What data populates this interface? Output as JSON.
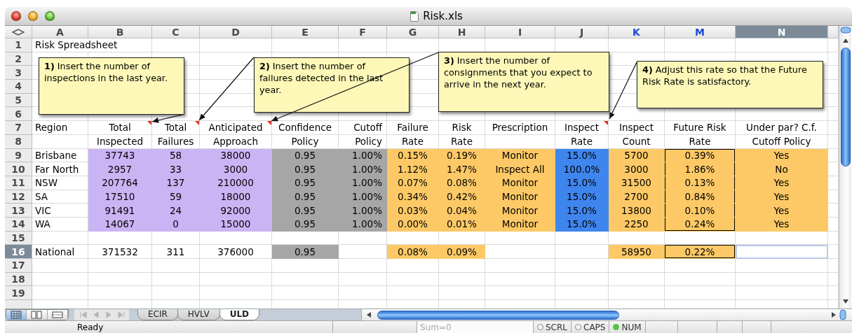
{
  "window": {
    "title": "Risk.xls"
  },
  "columns": [
    {
      "label": "A",
      "selected": false,
      "highlighted": false
    },
    {
      "label": "B",
      "selected": false,
      "highlighted": false
    },
    {
      "label": "C",
      "selected": false,
      "highlighted": false
    },
    {
      "label": "D",
      "selected": false,
      "highlighted": false
    },
    {
      "label": "E",
      "selected": false,
      "highlighted": false
    },
    {
      "label": "F",
      "selected": false,
      "highlighted": false
    },
    {
      "label": "G",
      "selected": false,
      "highlighted": false
    },
    {
      "label": "H",
      "selected": false,
      "highlighted": false
    },
    {
      "label": "I",
      "selected": false,
      "highlighted": false
    },
    {
      "label": "J",
      "selected": false,
      "highlighted": false
    },
    {
      "label": "K",
      "selected": false,
      "highlighted": true
    },
    {
      "label": "M",
      "selected": false,
      "highlighted": true
    },
    {
      "label": "N",
      "selected": true,
      "highlighted": false
    }
  ],
  "rows": [
    {
      "number": "1",
      "selected": false,
      "cells": [
        {
          "text": "Risk Spreadsheet",
          "comment": false,
          "boxed": false,
          "selected": false
        }
      ]
    },
    {
      "number": "2",
      "selected": false
    },
    {
      "number": "3",
      "selected": false
    },
    {
      "number": "4",
      "selected": false
    },
    {
      "number": "5",
      "selected": false
    },
    {
      "number": "6",
      "selected": false
    },
    {
      "number": "7",
      "selected": false,
      "cells": [
        {
          "text": "Region",
          "comment": false,
          "boxed": false,
          "selected": false
        },
        {
          "text": "Total",
          "comment": true,
          "boxed": false,
          "selected": false
        },
        {
          "text": "Total",
          "comment": true,
          "boxed": false,
          "selected": false
        },
        {
          "text": "Anticipated",
          "comment": true,
          "boxed": false,
          "selected": false
        },
        {
          "text": "Confidence",
          "comment": false,
          "boxed": false,
          "selected": false
        },
        {
          "text": "Cutoff",
          "comment": false,
          "boxed": false,
          "selected": false
        },
        {
          "text": "Failure",
          "comment": false,
          "boxed": false,
          "selected": false
        },
        {
          "text": "Risk",
          "comment": false,
          "boxed": false,
          "selected": false
        },
        {
          "text": "Prescription",
          "comment": false,
          "boxed": false,
          "selected": false
        },
        {
          "text": "Inspect",
          "comment": true,
          "boxed": false,
          "selected": false
        },
        {
          "text": "Inspect",
          "comment": false,
          "boxed": false,
          "selected": false
        },
        {
          "text": "Future Risk",
          "comment": false,
          "boxed": false,
          "selected": false
        },
        {
          "text": "Under par? C.f.",
          "comment": false,
          "boxed": false,
          "selected": false
        }
      ]
    },
    {
      "number": "8",
      "selected": false,
      "cells": [
        {
          "comment": false,
          "boxed": false,
          "selected": false
        },
        {
          "text": "Inspected",
          "comment": false,
          "boxed": false,
          "selected": false
        },
        {
          "text": "Failures",
          "comment": false,
          "boxed": false,
          "selected": false
        },
        {
          "text": "Approach",
          "comment": false,
          "boxed": false,
          "selected": false
        },
        {
          "text": "Policy",
          "comment": false,
          "boxed": false,
          "selected": false
        },
        {
          "text": "Policy",
          "comment": false,
          "boxed": false,
          "selected": false
        },
        {
          "text": "Rate",
          "comment": false,
          "boxed": false,
          "selected": false
        },
        {
          "text": "Rate",
          "comment": false,
          "boxed": false,
          "selected": false
        },
        {
          "comment": false,
          "boxed": false,
          "selected": false
        },
        {
          "text": "Rate",
          "comment": false,
          "boxed": false,
          "selected": false
        },
        {
          "text": "Count",
          "comment": false,
          "boxed": false,
          "selected": false
        },
        {
          "text": "Rate",
          "comment": false,
          "boxed": false,
          "selected": false
        },
        {
          "text": "Cutoff Policy",
          "comment": false,
          "boxed": false,
          "selected": false
        }
      ]
    },
    {
      "number": "9",
      "selected": false,
      "cells": [
        {
          "text": "Brisbane",
          "comment": false,
          "boxed": false,
          "selected": false
        },
        {
          "text": "37743",
          "color": "#cbb4f4",
          "comment": false,
          "boxed": false,
          "selected": false
        },
        {
          "text": "58",
          "color": "#cbb4f4",
          "comment": false,
          "boxed": false,
          "selected": false
        },
        {
          "text": "38000",
          "color": "#cbb4f4",
          "comment": false,
          "boxed": false,
          "selected": false
        },
        {
          "text": "0.95",
          "color": "#a6a6a6",
          "comment": false,
          "boxed": false,
          "selected": false
        },
        {
          "text": "1.00%",
          "color": "#a6a6a6",
          "comment": false,
          "boxed": false,
          "selected": false
        },
        {
          "text": "0.15%",
          "color": "#fcc966",
          "comment": false,
          "boxed": false,
          "selected": false
        },
        {
          "text": "0.19%",
          "color": "#fcc966",
          "comment": false,
          "boxed": false,
          "selected": false
        },
        {
          "text": "Monitor",
          "color": "#fcc966",
          "comment": false,
          "boxed": false,
          "selected": false
        },
        {
          "text": "15.0%",
          "color": "#3f85ee",
          "comment": false,
          "boxed": false,
          "selected": false
        },
        {
          "text": "5700",
          "color": "#fcc966",
          "comment": false,
          "boxed": false,
          "selected": false
        },
        {
          "text": "0.39%",
          "color": "#fcc966",
          "comment": false,
          "boxed": true,
          "selected": false
        },
        {
          "text": "Yes",
          "color": "#fcc966",
          "comment": false,
          "boxed": false,
          "selected": false
        }
      ]
    },
    {
      "number": "10",
      "selected": false,
      "cells": [
        {
          "text": "Far North",
          "comment": false,
          "boxed": false,
          "selected": false
        },
        {
          "text": "2957",
          "color": "#cbb4f4",
          "comment": false,
          "boxed": false,
          "selected": false
        },
        {
          "text": "33",
          "color": "#cbb4f4",
          "comment": false,
          "boxed": false,
          "selected": false
        },
        {
          "text": "3000",
          "color": "#cbb4f4",
          "comment": false,
          "boxed": false,
          "selected": false
        },
        {
          "text": "0.95",
          "color": "#a6a6a6",
          "comment": false,
          "boxed": false,
          "selected": false
        },
        {
          "text": "1.00%",
          "color": "#a6a6a6",
          "comment": false,
          "boxed": false,
          "selected": false
        },
        {
          "text": "1.12%",
          "color": "#fcc966",
          "comment": false,
          "boxed": false,
          "selected": false
        },
        {
          "text": "1.47%",
          "color": "#fcc966",
          "comment": false,
          "boxed": false,
          "selected": false
        },
        {
          "text": "Inspect All",
          "color": "#fcc966",
          "comment": false,
          "boxed": false,
          "selected": false
        },
        {
          "text": "100.0%",
          "color": "#3f85ee",
          "comment": false,
          "boxed": false,
          "selected": false
        },
        {
          "text": "3000",
          "color": "#fcc966",
          "comment": false,
          "boxed": false,
          "selected": false
        },
        {
          "text": "1.86%",
          "color": "#fcc966",
          "comment": false,
          "boxed": true,
          "selected": false
        },
        {
          "text": "No",
          "color": "#fcc966",
          "comment": false,
          "boxed": false,
          "selected": false
        }
      ]
    },
    {
      "number": "11",
      "selected": false,
      "cells": [
        {
          "text": "NSW",
          "comment": false,
          "boxed": false,
          "selected": false
        },
        {
          "text": "207764",
          "color": "#cbb4f4",
          "comment": false,
          "boxed": false,
          "selected": false
        },
        {
          "text": "137",
          "color": "#cbb4f4",
          "comment": false,
          "boxed": false,
          "selected": false
        },
        {
          "text": "210000",
          "color": "#cbb4f4",
          "comment": false,
          "boxed": false,
          "selected": false
        },
        {
          "text": "0.95",
          "color": "#a6a6a6",
          "comment": false,
          "boxed": false,
          "selected": false
        },
        {
          "text": "1.00%",
          "color": "#a6a6a6",
          "comment": false,
          "boxed": false,
          "selected": false
        },
        {
          "text": "0.07%",
          "color": "#fcc966",
          "comment": false,
          "boxed": false,
          "selected": false
        },
        {
          "text": "0.08%",
          "color": "#fcc966",
          "comment": false,
          "boxed": false,
          "selected": false
        },
        {
          "text": "Monitor",
          "color": "#fcc966",
          "comment": false,
          "boxed": false,
          "selected": false
        },
        {
          "text": "15.0%",
          "color": "#3f85ee",
          "comment": false,
          "boxed": false,
          "selected": false
        },
        {
          "text": "31500",
          "color": "#fcc966",
          "comment": false,
          "boxed": false,
          "selected": false
        },
        {
          "text": "0.13%",
          "color": "#fcc966",
          "comment": false,
          "boxed": true,
          "selected": false
        },
        {
          "text": "Yes",
          "color": "#fcc966",
          "comment": false,
          "boxed": false,
          "selected": false
        }
      ]
    },
    {
      "number": "12",
      "selected": false,
      "cells": [
        {
          "text": "SA",
          "comment": false,
          "boxed": false,
          "selected": false
        },
        {
          "text": "17510",
          "color": "#cbb4f4",
          "comment": false,
          "boxed": false,
          "selected": false
        },
        {
          "text": "59",
          "color": "#cbb4f4",
          "comment": false,
          "boxed": false,
          "selected": false
        },
        {
          "text": "18000",
          "color": "#cbb4f4",
          "comment": false,
          "boxed": false,
          "selected": false
        },
        {
          "text": "0.95",
          "color": "#a6a6a6",
          "comment": false,
          "boxed": false,
          "selected": false
        },
        {
          "text": "1.00%",
          "color": "#a6a6a6",
          "comment": false,
          "boxed": false,
          "selected": false
        },
        {
          "text": "0.34%",
          "color": "#fcc966",
          "comment": false,
          "boxed": false,
          "selected": false
        },
        {
          "text": "0.42%",
          "color": "#fcc966",
          "comment": false,
          "boxed": false,
          "selected": false
        },
        {
          "text": "Monitor",
          "color": "#fcc966",
          "comment": false,
          "boxed": false,
          "selected": false
        },
        {
          "text": "15.0%",
          "color": "#3f85ee",
          "comment": false,
          "boxed": false,
          "selected": false
        },
        {
          "text": "2700",
          "color": "#fcc966",
          "comment": false,
          "boxed": false,
          "selected": false
        },
        {
          "text": "0.84%",
          "color": "#fcc966",
          "comment": false,
          "boxed": true,
          "selected": false
        },
        {
          "text": "Yes",
          "color": "#fcc966",
          "comment": false,
          "boxed": false,
          "selected": false
        }
      ]
    },
    {
      "number": "13",
      "selected": false,
      "cells": [
        {
          "text": "VIC",
          "comment": false,
          "boxed": false,
          "selected": false
        },
        {
          "text": "91491",
          "color": "#cbb4f4",
          "comment": false,
          "boxed": false,
          "selected": false
        },
        {
          "text": "24",
          "color": "#cbb4f4",
          "comment": false,
          "boxed": false,
          "selected": false
        },
        {
          "text": "92000",
          "color": "#cbb4f4",
          "comment": false,
          "boxed": false,
          "selected": false
        },
        {
          "text": "0.95",
          "color": "#a6a6a6",
          "comment": false,
          "boxed": false,
          "selected": false
        },
        {
          "text": "1.00%",
          "color": "#a6a6a6",
          "comment": false,
          "boxed": false,
          "selected": false
        },
        {
          "text": "0.03%",
          "color": "#fcc966",
          "comment": false,
          "boxed": false,
          "selected": false
        },
        {
          "text": "0.04%",
          "color": "#fcc966",
          "comment": false,
          "boxed": false,
          "selected": false
        },
        {
          "text": "Monitor",
          "color": "#fcc966",
          "comment": false,
          "boxed": false,
          "selected": false
        },
        {
          "text": "15.0%",
          "color": "#3f85ee",
          "comment": false,
          "boxed": false,
          "selected": false
        },
        {
          "text": "13800",
          "color": "#fcc966",
          "comment": false,
          "boxed": false,
          "selected": false
        },
        {
          "text": "0.10%",
          "color": "#fcc966",
          "comment": false,
          "boxed": true,
          "selected": false
        },
        {
          "text": "Yes",
          "color": "#fcc966",
          "comment": false,
          "boxed": false,
          "selected": false
        }
      ]
    },
    {
      "number": "14",
      "selected": false,
      "cells": [
        {
          "text": "WA",
          "comment": false,
          "boxed": false,
          "selected": false
        },
        {
          "text": "14067",
          "color": "#cbb4f4",
          "comment": false,
          "boxed": false,
          "selected": false
        },
        {
          "text": "0",
          "color": "#cbb4f4",
          "comment": false,
          "boxed": false,
          "selected": false
        },
        {
          "text": "15000",
          "color": "#cbb4f4",
          "comment": false,
          "boxed": false,
          "selected": false
        },
        {
          "text": "0.95",
          "color": "#a6a6a6",
          "comment": false,
          "boxed": false,
          "selected": false
        },
        {
          "text": "1.00%",
          "color": "#a6a6a6",
          "comment": false,
          "boxed": false,
          "selected": false
        },
        {
          "text": "0.00%",
          "color": "#fcc966",
          "comment": false,
          "boxed": false,
          "selected": false
        },
        {
          "text": "0.01%",
          "color": "#fcc966",
          "comment": false,
          "boxed": false,
          "selected": false
        },
        {
          "text": "Monitor",
          "color": "#fcc966",
          "comment": false,
          "boxed": false,
          "selected": false
        },
        {
          "text": "15.0%",
          "color": "#3f85ee",
          "comment": false,
          "boxed": false,
          "selected": false
        },
        {
          "text": "2250",
          "color": "#fcc966",
          "comment": false,
          "boxed": false,
          "selected": false
        },
        {
          "text": "0.24%",
          "color": "#fcc966",
          "comment": false,
          "boxed": true,
          "selected": false
        },
        {
          "text": "Yes",
          "color": "#fcc966",
          "comment": false,
          "boxed": false,
          "selected": false
        }
      ]
    },
    {
      "number": "15",
      "selected": false
    },
    {
      "number": "16",
      "selected": true,
      "cells": [
        {
          "text": "National",
          "comment": false,
          "boxed": false,
          "selected": false
        },
        {
          "text": "371532",
          "comment": false,
          "boxed": false,
          "selected": false
        },
        {
          "text": "311",
          "comment": false,
          "boxed": false,
          "selected": false
        },
        {
          "text": "376000",
          "comment": false,
          "boxed": false,
          "selected": false
        },
        {
          "text": "0.95",
          "color": "#a6a6a6",
          "comment": false,
          "boxed": false,
          "selected": false
        },
        {
          "comment": false,
          "boxed": false,
          "selected": false
        },
        {
          "text": "0.08%",
          "color": "#fcc966",
          "comment": false,
          "boxed": false,
          "selected": false
        },
        {
          "text": "0.09%",
          "color": "#fcc966",
          "comment": false,
          "boxed": false,
          "selected": false
        },
        {
          "comment": false,
          "boxed": false,
          "selected": false
        },
        {
          "comment": false,
          "boxed": false,
          "selected": false
        },
        {
          "text": "58950",
          "color": "#fcc966",
          "comment": false,
          "boxed": false,
          "selected": false
        },
        {
          "text": "0.22%",
          "color": "#fcc966",
          "comment": false,
          "boxed": true,
          "selected": false
        },
        {
          "comment": false,
          "boxed": false,
          "selected": true
        }
      ]
    },
    {
      "number": "17",
      "selected": false
    },
    {
      "number": "18",
      "selected": false
    },
    {
      "number": "19",
      "selected": false
    },
    {
      "selected": false
    }
  ],
  "comments": [
    "**1)** Insert the number of inspections in the last year.",
    "**2)** Insert the number of failures detected in the last year.",
    "**3)** Insert the number of consignments that you expect to arrive in the next year.",
    "**4)** Adjust this rate so that the Future Risk Rate is satisfactory."
  ],
  "sheets": [
    {
      "label": "ECIR",
      "selected": false
    },
    {
      "label": "HVLV",
      "selected": false
    },
    {
      "label": "ULD",
      "selected": true
    }
  ],
  "views": [
    {
      "selected": true
    },
    {
      "selected": false
    },
    {
      "selected": false
    }
  ],
  "status_bar": {
    "text": "Ready",
    "sum": "Sum=0",
    "indicators": [
      {
        "label": "SCRL",
        "on": false
      },
      {
        "label": "CAPS",
        "on": false
      },
      {
        "label": "NUM",
        "on": true
      }
    ]
  }
}
